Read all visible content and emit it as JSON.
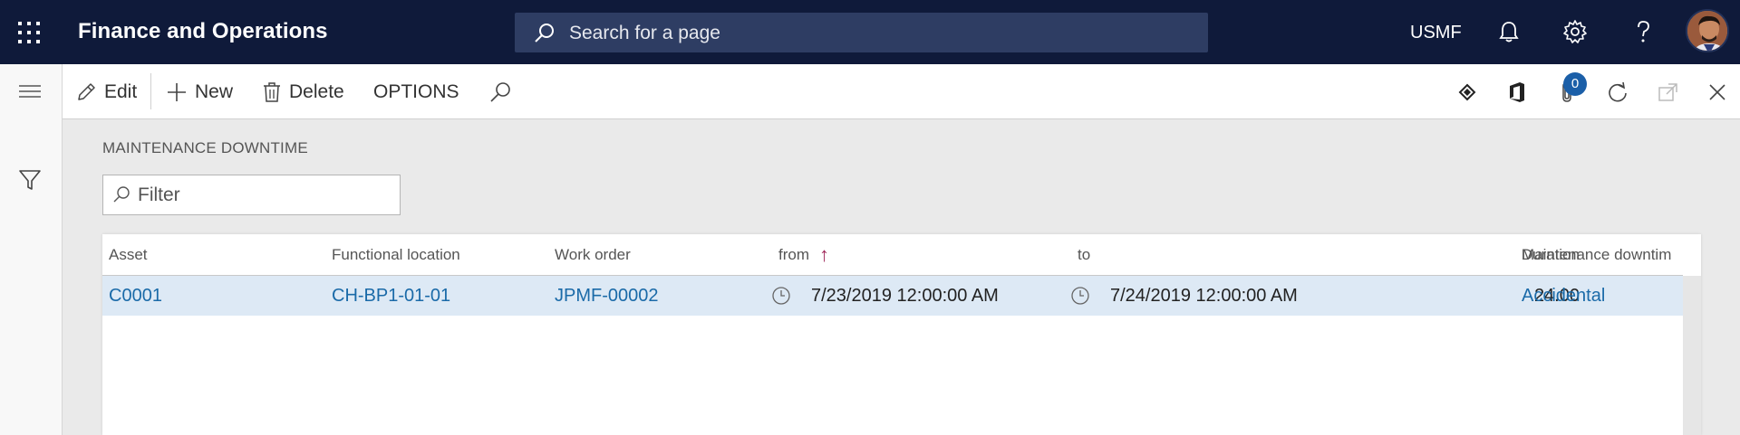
{
  "topbar": {
    "app_title": "Finance and Operations",
    "search_placeholder": "Search for a page",
    "company": "USMF"
  },
  "actions": {
    "edit": "Edit",
    "new": "New",
    "delete": "Delete",
    "options": "OPTIONS",
    "attachments_count": "0"
  },
  "page": {
    "caption": "MAINTENANCE DOWNTIME",
    "filter_placeholder": "Filter"
  },
  "grid": {
    "columns": {
      "asset": "Asset",
      "functional_location": "Functional location",
      "work_order": "Work order",
      "from": "from",
      "to": "to",
      "duration": "Duration",
      "maintenance_downtime": "Maintenance downtim"
    },
    "sort_indicator": "↑",
    "rows": [
      {
        "asset": "C0001",
        "functional_location": "CH-BP1-01-01",
        "work_order": "JPMF-00002",
        "from": "7/23/2019 12:00:00 AM",
        "to": "7/24/2019 12:00:00 AM",
        "duration": "24.00",
        "maintenance_downtime": "Accidental"
      }
    ]
  },
  "colors": {
    "topbar": "#0f1a3a",
    "search": "#2e3d63",
    "link": "#1a6aa8",
    "selected_row": "#dde9f5",
    "badge": "#1b5fa8"
  },
  "icons": [
    "app-launcher-icon",
    "search-icon",
    "bell-icon",
    "gear-icon",
    "help-icon",
    "hamburger-icon",
    "filter-icon",
    "edit-icon",
    "plus-icon",
    "trash-icon",
    "diamond-icon",
    "office-icon",
    "paperclip-icon",
    "refresh-icon",
    "popout-icon",
    "close-icon",
    "clock-icon",
    "sort-up-icon"
  ]
}
